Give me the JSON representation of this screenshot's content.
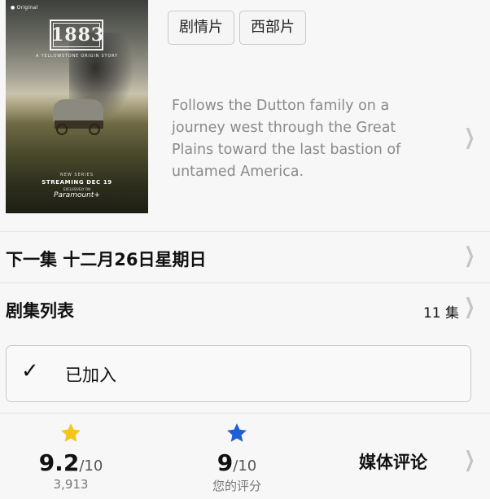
{
  "poster": {
    "brand": "Original",
    "title": "1883",
    "subtitle": "A YELLOWSTONE ORIGIN STORY",
    "new_series": "NEW SERIES",
    "streaming": "STREAMING DEC 19",
    "exclusively": "EXCLUSIVELY ON",
    "platform": "Paramount+"
  },
  "genres": [
    "剧情片",
    "西部片"
  ],
  "synopsis": "Follows the Dutton family on a journey west through the Great Plains toward the last bastion of untamed America.",
  "next_episode": {
    "label": "下一集 十二月26日星期日"
  },
  "episode_list": {
    "label": "剧集列表",
    "count": "11 集"
  },
  "library": {
    "label": "已加入"
  },
  "ratings": {
    "imdb": {
      "score": "9.2",
      "out_of": "/10",
      "votes": "3,913",
      "star_color": "#f5c518"
    },
    "user": {
      "score": "9",
      "out_of": "/10",
      "label": "您的评分",
      "star_color": "#1f5fd6"
    },
    "media_reviews": "媒体评论"
  }
}
